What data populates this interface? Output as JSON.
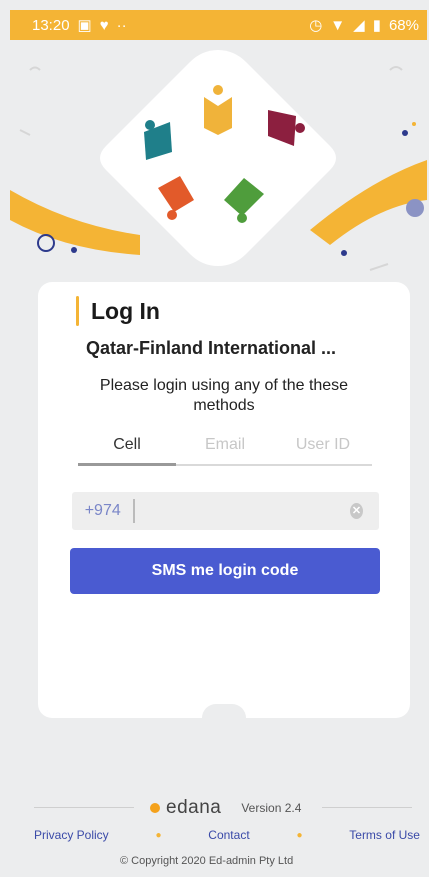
{
  "status_bar": {
    "time": "13:20",
    "notification_icons": [
      "image-icon",
      "heart-icon",
      "more-dots-icon"
    ],
    "system_icons": [
      "alarm-icon",
      "wifi-icon",
      "signal-icon",
      "battery-icon"
    ],
    "battery": "68%"
  },
  "login": {
    "title": "Log In",
    "school_name": "Qatar-Finland International ...",
    "instructions": "Please login using any of the these methods",
    "tabs": [
      {
        "label": "Cell",
        "active": true
      },
      {
        "label": "Email",
        "active": false
      },
      {
        "label": "User ID",
        "active": false
      }
    ],
    "country_code": "+974",
    "phone_value": "",
    "sms_button": "SMS me login code"
  },
  "footer": {
    "brand": "edana",
    "version": "Version 2.4",
    "links": [
      "Privacy Policy",
      "Contact",
      "Terms of Use"
    ],
    "copyright": "© Copyright 2020 Ed-admin Pty Ltd"
  },
  "colors": {
    "accent": "#f4b435",
    "button": "#4a5bd1",
    "logo_yellow": "#f0b33a",
    "logo_maroon": "#8c1f3f",
    "logo_teal": "#1f7f8a",
    "logo_orange": "#e25a2a",
    "logo_green": "#4f9d3c"
  }
}
